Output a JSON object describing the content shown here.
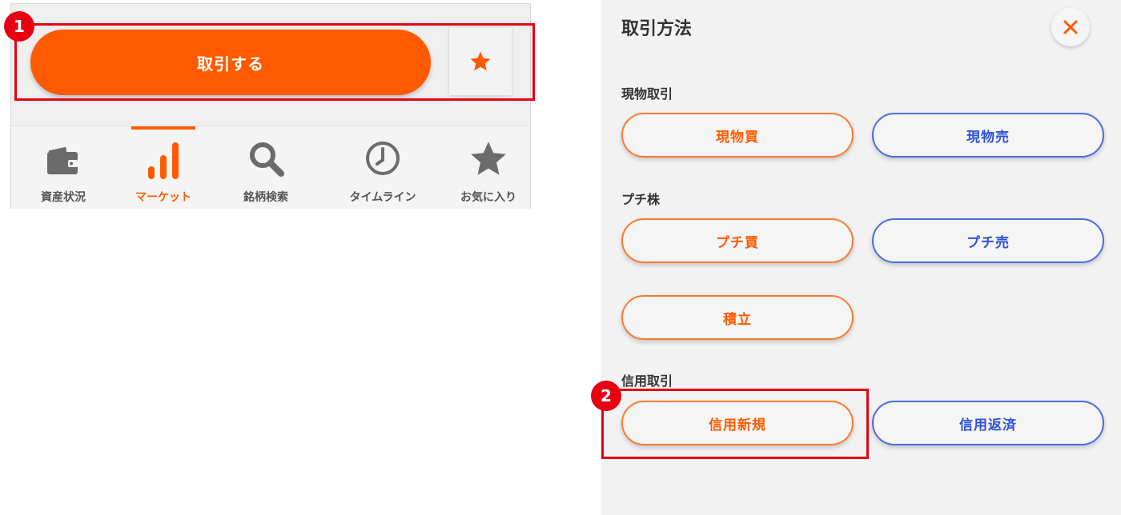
{
  "badges": {
    "one": "1",
    "two": "2"
  },
  "action_bar": {
    "trade_label": "取引する",
    "favorite_icon": "star-icon"
  },
  "tabs": [
    {
      "label": "資産状況",
      "icon": "wallet-icon",
      "active": false
    },
    {
      "label": "マーケット",
      "icon": "bar-chart-icon",
      "active": true
    },
    {
      "label": "銘柄検索",
      "icon": "search-icon",
      "active": false
    },
    {
      "label": "タイムライン",
      "icon": "clock-icon",
      "active": false
    },
    {
      "label": "お気に入り",
      "icon": "star-icon",
      "active": false
    }
  ],
  "sheet": {
    "title": "取引方法",
    "sections": [
      {
        "label": "現物取引",
        "buttons": [
          "現物買",
          "現物売"
        ]
      },
      {
        "label": "プチ株",
        "buttons": [
          "プチ買",
          "プチ売",
          "積立"
        ]
      },
      {
        "label": "信用取引",
        "buttons": [
          "信用新規",
          "信用返済"
        ]
      }
    ]
  },
  "colors": {
    "accent": "#ff5a00",
    "sell_blue": "#2e52d6",
    "highlight_red": "#e60012",
    "icon_gray": "#6b6b6b"
  }
}
